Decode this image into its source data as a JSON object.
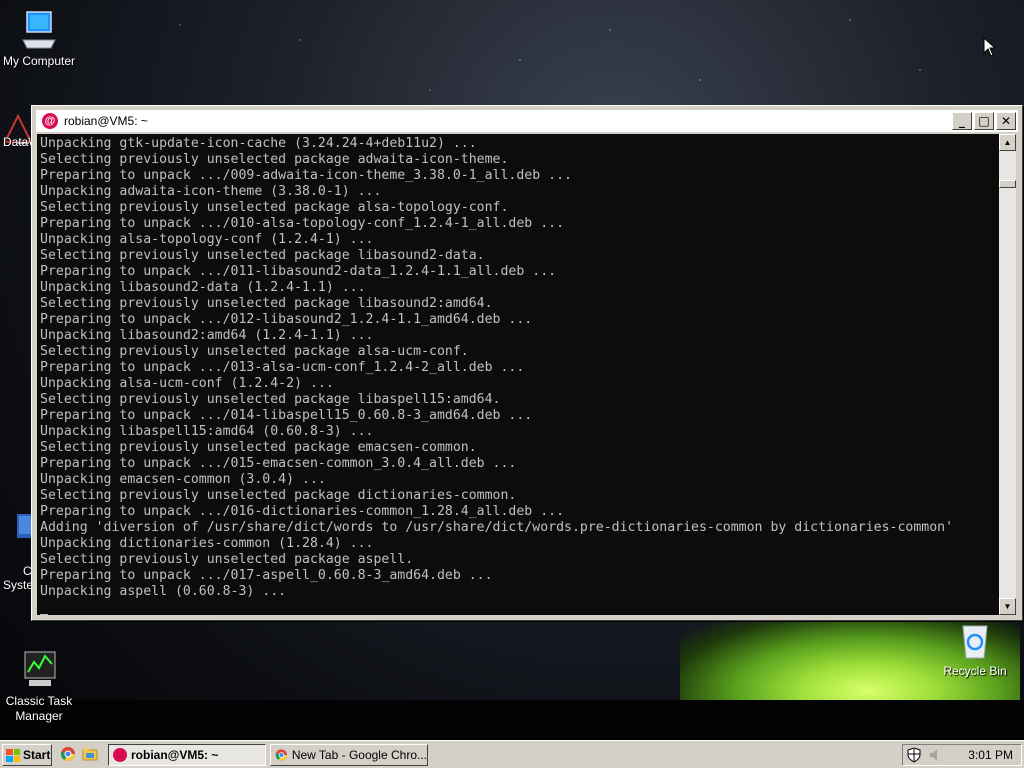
{
  "desktop": {
    "icons": {
      "my_computer": "My Computer",
      "partial_data": "Data\\",
      "partial_c": "C",
      "partial_syste": "Syste",
      "classic_task_manager": "Classic Task\nManager",
      "recycle_bin": "Recycle Bin"
    }
  },
  "window": {
    "title": "robian@VM5: ~",
    "buttons": {
      "minimize": "_",
      "maximize": "□",
      "close": "✕"
    },
    "console_lines": [
      "Unpacking gtk-update-icon-cache (3.24.24-4+deb11u2) ...",
      "Selecting previously unselected package adwaita-icon-theme.",
      "Preparing to unpack .../009-adwaita-icon-theme_3.38.0-1_all.deb ...",
      "Unpacking adwaita-icon-theme (3.38.0-1) ...",
      "Selecting previously unselected package alsa-topology-conf.",
      "Preparing to unpack .../010-alsa-topology-conf_1.2.4-1_all.deb ...",
      "Unpacking alsa-topology-conf (1.2.4-1) ...",
      "Selecting previously unselected package libasound2-data.",
      "Preparing to unpack .../011-libasound2-data_1.2.4-1.1_all.deb ...",
      "Unpacking libasound2-data (1.2.4-1.1) ...",
      "Selecting previously unselected package libasound2:amd64.",
      "Preparing to unpack .../012-libasound2_1.2.4-1.1_amd64.deb ...",
      "Unpacking libasound2:amd64 (1.2.4-1.1) ...",
      "Selecting previously unselected package alsa-ucm-conf.",
      "Preparing to unpack .../013-alsa-ucm-conf_1.2.4-2_all.deb ...",
      "Unpacking alsa-ucm-conf (1.2.4-2) ...",
      "Selecting previously unselected package libaspell15:amd64.",
      "Preparing to unpack .../014-libaspell15_0.60.8-3_amd64.deb ...",
      "Unpacking libaspell15:amd64 (0.60.8-3) ...",
      "Selecting previously unselected package emacsen-common.",
      "Preparing to unpack .../015-emacsen-common_3.0.4_all.deb ...",
      "Unpacking emacsen-common (3.0.4) ...",
      "Selecting previously unselected package dictionaries-common.",
      "Preparing to unpack .../016-dictionaries-common_1.28.4_all.deb ...",
      "Adding 'diversion of /usr/share/dict/words to /usr/share/dict/words.pre-dictionaries-common by dictionaries-common'",
      "Unpacking dictionaries-common (1.28.4) ...",
      "Selecting previously unselected package aspell.",
      "Preparing to unpack .../017-aspell_0.60.8-3_amd64.deb ...",
      "Unpacking aspell (0.60.8-3) ..."
    ]
  },
  "taskbar": {
    "start_label": "Start",
    "tasks": [
      {
        "label": "robian@VM5: ~",
        "icon": "debian-icon",
        "active": true
      },
      {
        "label": "New Tab - Google Chro...",
        "icon": "chrome-icon",
        "active": false
      }
    ],
    "clock": "3:01 PM"
  },
  "colors": {
    "debian_red": "#d70a53",
    "console_bg": "#0c0c0c",
    "console_fg": "#c0c0c0",
    "taskbar_bg": "#d4d0c8"
  }
}
